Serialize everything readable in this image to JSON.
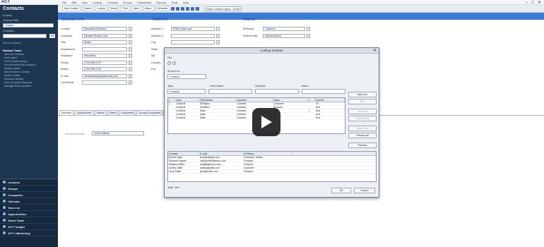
{
  "app": {
    "logo": "ACT"
  },
  "menu": [
    "File",
    "Edit",
    "View",
    "Lookup",
    "Contacts",
    "Groups",
    "Companies",
    "Reports",
    "Tools",
    "Help"
  ],
  "window_controls": [
    "–",
    "□",
    "✕"
  ],
  "sidebar": {
    "title": "Contacts",
    "lookup_label": "Lookup",
    "lookup_by_label": "Contact field",
    "lookup_select": "Contact",
    "contains_label": "Contains",
    "go_label": "Go",
    "advanced_label": "More Lookups",
    "tasks_header": "Related Tasks",
    "tasks": [
      "View All Contacts",
      "Find Latest",
      "Find Contact Access",
      "Find Records Not Accessed",
      "Modify Layout",
      "Send Email to Contact",
      "Email Contact",
      "Schedule Activity",
      "View Groups/Companies",
      "Manage Social Updates"
    ],
    "nav": [
      {
        "label": "Contacts",
        "icon": "contacts-icon"
      },
      {
        "label": "Groups",
        "icon": "groups-icon"
      },
      {
        "label": "Companies",
        "icon": "companies-icon"
      },
      {
        "label": "Calendar",
        "icon": "calendar-icon"
      },
      {
        "label": "Task List",
        "icon": "task-list-icon"
      },
      {
        "label": "Opportunities",
        "icon": "opportunities-icon"
      },
      {
        "label": "Smart Tasks",
        "icon": "smart-tasks-icon"
      },
      {
        "label": "ACT! Insight",
        "icon": "insight-icon"
      },
      {
        "label": "ACT! eMarketing",
        "icon": "emarketing-icon"
      }
    ]
  },
  "ribbon": {
    "buttons": [
      "New Contact",
      "Delete",
      "Lookup",
      "Email",
      "Print",
      "Save",
      "Attach",
      "Schedule"
    ],
    "layout_select": "Basic Contact Layout - 1024x768"
  },
  "detail": {
    "section1": "Contact Info",
    "section2": "Address",
    "section3": "Status",
    "fields_left": [
      {
        "label": "Contact",
        "value": "Samantha Smithson"
      },
      {
        "label": "Company",
        "value": "Paradise Realty Corp"
      },
      {
        "label": "Title",
        "value": "Broker"
      },
      {
        "label": "Department",
        "value": ""
      },
      {
        "label": "Salutation",
        "value": "Samantha"
      },
      {
        "label": "Phone",
        "value": "(719) 555-0179"
      },
      {
        "label": "Mobile",
        "value": "(719) 555-0176"
      },
      {
        "label": "E-mail",
        "value": "samantha@paradiserealty.com"
      },
      {
        "label": "Call Result",
        "value": ""
      }
    ],
    "fields_mid": [
      {
        "label": "Address 1",
        "value": "5755 Cedar Lane"
      },
      {
        "label": "Address 2",
        "value": ""
      },
      {
        "label": "City",
        "value": ""
      },
      {
        "label": "State",
        "value": ""
      },
      {
        "label": "Zip",
        "value": ""
      },
      {
        "label": "Country",
        "value": ""
      },
      {
        "label": "Fax",
        "value": ""
      }
    ],
    "fields_right": [
      {
        "label": "ID/Status",
        "value": "Customer"
      },
      {
        "label": "Referred By",
        "value": "Internet Advert"
      }
    ]
  },
  "tabs": [
    "Activities",
    "Opportunities",
    "History",
    "Notes",
    "Documents",
    "Groups/Companies",
    "Secondary Contacts",
    "Personal Info",
    "Contact Info",
    "User Fields",
    "Home Address"
  ],
  "tab_body": {
    "field_label": "Record Manager",
    "field_value": "Chris Huffman"
  },
  "dialog": {
    "title": "Lookup Contact",
    "menu": "File",
    "search_for_label": "Search for:",
    "search_for_value": "Contacts",
    "type_label": "Type",
    "field_name_label": "Field Name",
    "operator_label": "Operator",
    "value_label": "Value",
    "type_value": "Contacts",
    "buttons_right": [
      "Add Line",
      "Edit",
      "Save As",
      "Save Query",
      "Clear Map",
      "Preview All",
      "Preview"
    ],
    "criteria_headers": [
      "(",
      "Type",
      "Field Name",
      "Operator",
      "Value",
      ")",
      "And/Or"
    ],
    "criteria_rows": [
      [
        "(",
        "Contacts",
        "ID/Status",
        "Contains",
        "Customer",
        "",
        "Or"
      ],
      [
        "",
        "Contacts",
        "ID/Status",
        "Contains",
        "Prospect",
        "",
        "And"
      ],
      [
        "",
        "Contacts",
        "State",
        "Contains",
        "CA",
        ")",
        "And"
      ],
      [
        "",
        "Contacts",
        "State",
        "Contains",
        "NY",
        "",
        "And"
      ],
      [
        "",
        "Contacts",
        "State",
        "Contains",
        "TX",
        "",
        "End"
      ]
    ],
    "results_headers": [
      "Contact",
      "E-mail",
      "ID/Status"
    ],
    "results_rows": [
      [
        "Bonnie Ingle",
        "bonnie@ingle.com",
        "Customer; Vendor"
      ],
      [
        "Maureen Ingram",
        "mjm@whiteharbour.com",
        "Prospect"
      ],
      [
        "Melissa Gilbert",
        "melgilb@bmco.com",
        "Prospect"
      ],
      [
        "Ashley Jaffer",
        "ashley@jaffer.com",
        "Customer"
      ],
      [
        "Jerry Smith",
        "jerry@smith.com",
        "Prospect"
      ]
    ],
    "status": "Total: 169",
    "ok": "OK",
    "cancel": "Cancel"
  }
}
